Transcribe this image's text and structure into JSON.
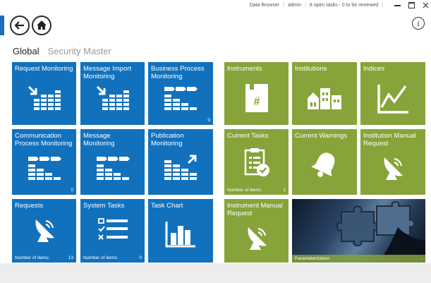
{
  "topbar": {
    "app_name": "Data Browser",
    "user": "admin",
    "tasks_status": "8 open tasks - 0 to be reviewed"
  },
  "tabs": [
    {
      "label": "Global",
      "active": true
    },
    {
      "label": "Security Master",
      "active": false
    }
  ],
  "colors": {
    "blue_tile": "#1171bd",
    "green_tile": "#86a43a",
    "accent": "#1a6fb8"
  },
  "tiles": {
    "request_monitoring": {
      "title": "Request Monitoring",
      "icon": "monitoring-arrow-icon"
    },
    "message_import_monitoring": {
      "title": "Message Import Monitoring",
      "icon": "monitoring-arrow-icon"
    },
    "business_process_monitoring": {
      "title": "Business Process Monitoring",
      "count": "0",
      "icon": "process-flow-icon"
    },
    "communication_process_monitoring": {
      "title": "Communication Process Monitoring",
      "count": "0",
      "icon": "process-flow-icon"
    },
    "message_monitoring": {
      "title": "Message Monitoring",
      "icon": "process-flow-icon"
    },
    "publication_monitoring": {
      "title": "Publication Monitoring",
      "icon": "publication-chart-icon"
    },
    "requests": {
      "title": "Requests",
      "items_label": "Number of items:",
      "items_value": "13",
      "icon": "satellite-dish-icon"
    },
    "system_tasks": {
      "title": "System Tasks",
      "items_label": "Number of items:",
      "items_value": "0",
      "icon": "checklist-icon"
    },
    "task_chart": {
      "title": "Task Chart",
      "icon": "bar-chart-icon"
    },
    "instruments": {
      "title": "Instruments",
      "icon": "hash-document-icon"
    },
    "institutions": {
      "title": "Institutions",
      "icon": "buildings-icon"
    },
    "indices": {
      "title": "Indices",
      "icon": "line-graph-icon"
    },
    "current_tasks": {
      "title": "Current Tasks",
      "items_label": "Number of items:",
      "items_value": "1",
      "icon": "clipboard-check-icon"
    },
    "current_warnings": {
      "title": "Current Warnings",
      "icon": "bell-icon"
    },
    "institution_manual_request": {
      "title": "Institution Manual Request",
      "icon": "satellite-dish-icon"
    },
    "instrument_manual_request": {
      "title": "Instrument Manual Request",
      "icon": "satellite-dish-icon"
    },
    "parameterization": {
      "title": "Parameterization",
      "count": "-",
      "icon": "puzzle-photo"
    }
  }
}
